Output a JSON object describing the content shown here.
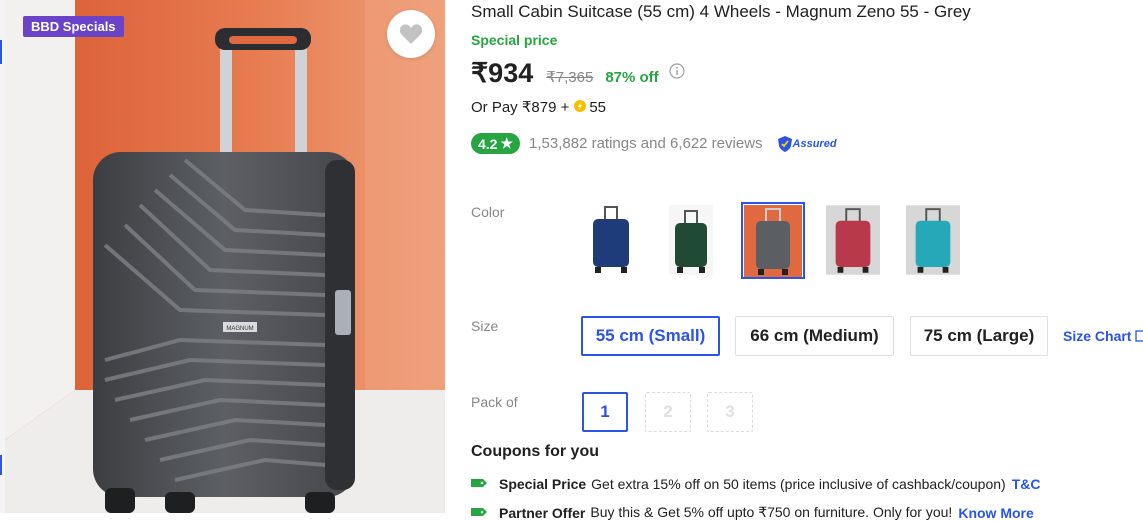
{
  "badge": "BBD Specials",
  "product": {
    "title": "Small Cabin Suitcase (55 cm) 4 Wheels - Magnum Zeno 55 - Grey",
    "special_price_label": "Special price",
    "price": "₹934",
    "mrp": "₹7,365",
    "discount": "87% off",
    "or_pay_prefix": "Or Pay ₹879 + ",
    "or_pay_coins": "55",
    "rating": "4.2",
    "rating_text": "1,53,882 ratings and 6,622 reviews",
    "assured_label": "Assured",
    "brand_on_case": "MAGNUM"
  },
  "variants": {
    "color_label": "Color",
    "colors": [
      {
        "name": "navy",
        "hex": "#1f3c7a"
      },
      {
        "name": "green",
        "hex": "#1f4a33"
      },
      {
        "name": "grey",
        "hex": "#5b5e63"
      },
      {
        "name": "red",
        "hex": "#b83a4a"
      },
      {
        "name": "teal",
        "hex": "#25a9b8"
      }
    ],
    "selected_color": "grey",
    "size_label": "Size",
    "sizes": [
      "55 cm (Small)",
      "66 cm (Medium)",
      "75 cm (Large)"
    ],
    "selected_size": "55 cm (Small)",
    "size_chart_label": "Size Chart",
    "pack_label": "Pack of",
    "packs": [
      "1",
      "2",
      "3"
    ],
    "selected_pack": "1"
  },
  "coupons": {
    "title": "Coupons for you",
    "offers": [
      {
        "type": "Special Price",
        "text": "Get extra 15% off on 50 items (price inclusive of cashback/coupon)",
        "link": "T&C"
      },
      {
        "type": "Partner Offer",
        "text": "Buy this & Get 5% off upto ₹750 on furniture. Only for you!",
        "link": "Know More"
      }
    ]
  },
  "colors": {
    "accent": "#2a55e5",
    "success": "#26a541",
    "badge": "#6a43c8",
    "muted": "#878787"
  }
}
